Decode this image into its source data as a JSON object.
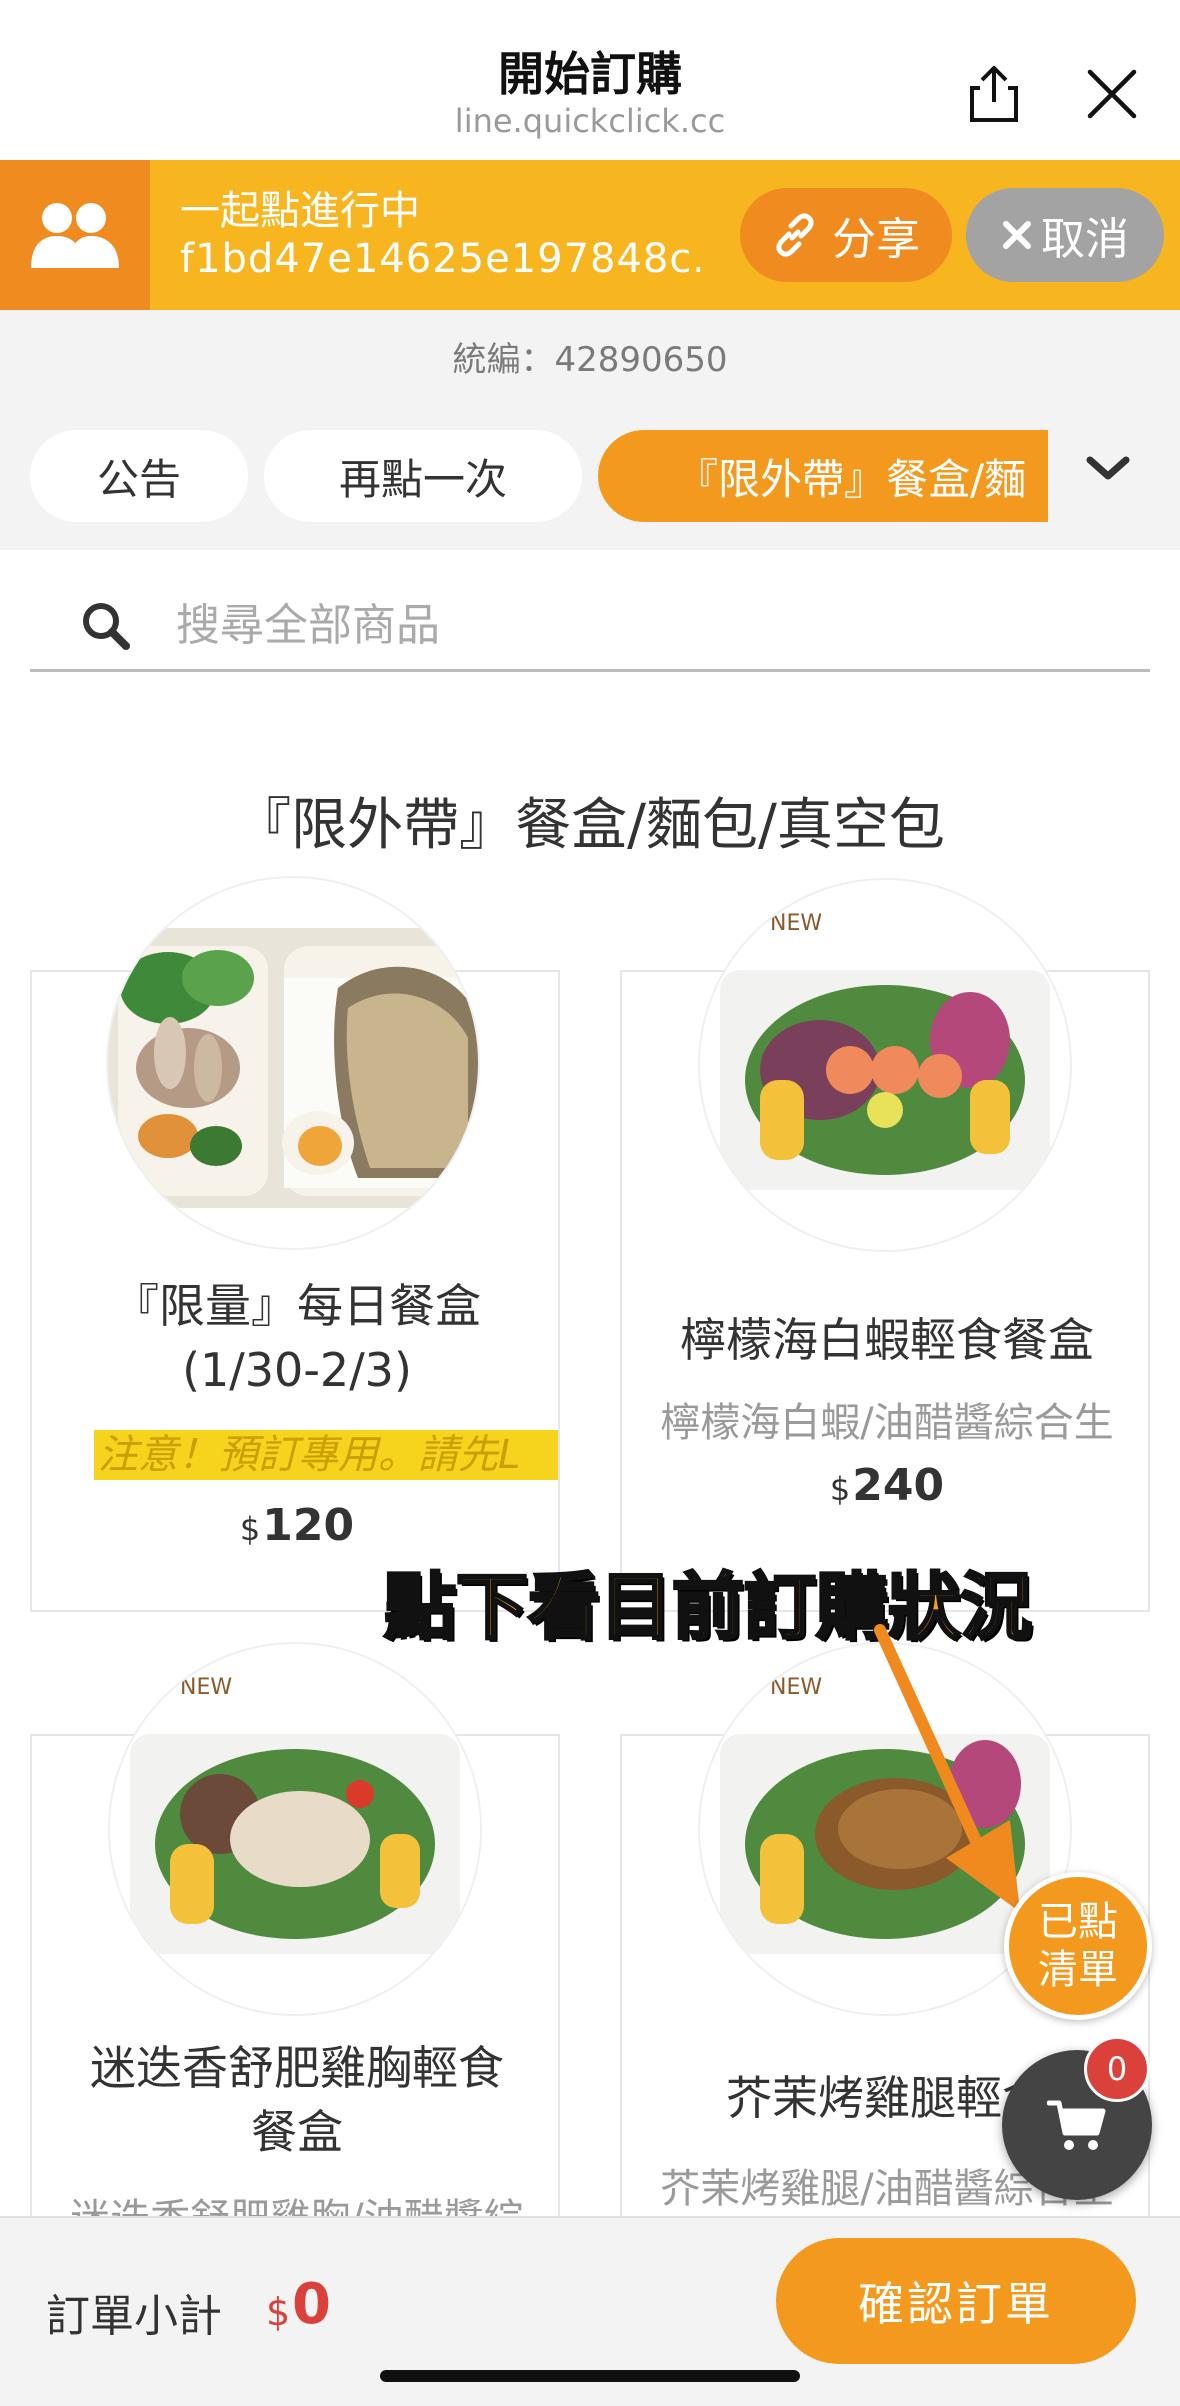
{
  "header": {
    "title": "開始訂購",
    "url": "line.quickclick.cc",
    "share_icon": "share-icon",
    "close_icon": "close-icon"
  },
  "group_order": {
    "status": "一起點進行中",
    "code": "f1bd47e14625e197848c...",
    "share_label": "分享",
    "cancel_label": "取消"
  },
  "store": {
    "tax_id": "統編：42890650"
  },
  "tabs": [
    {
      "label": "公告"
    },
    {
      "label": "再點一次"
    },
    {
      "label": "『限外帶』餐盒/麵",
      "active": true
    }
  ],
  "search": {
    "placeholder": "搜尋全部商品",
    "value": ""
  },
  "section": {
    "title": "『限外帶』餐盒/麵包/真空包"
  },
  "products": [
    {
      "name_line1": "『限量』每日餐盒",
      "name_line2": "(1/30-2/3)",
      "note": "注意！預訂專用。請先L",
      "currency": "$",
      "price": "120"
    },
    {
      "name": "檸檬海白蝦輕食餐盒",
      "desc": "檸檬海白蝦/油醋醬綜合生",
      "currency": "$",
      "price": "240"
    },
    {
      "name_line1": "迷迭香舒肥雞胸輕食",
      "name_line2": "餐盒",
      "desc": "迷迭香舒肥雞胸/油醋醬綜"
    },
    {
      "name": "芥茉烤雞腿輕食",
      "desc": "芥茉烤雞腿/油醋醬綜合生"
    }
  ],
  "annotation": {
    "text": "點下看目前訂購狀況"
  },
  "floating": {
    "list_label_line1": "已點",
    "list_label_line2": "清單",
    "cart_count": "0"
  },
  "bottom": {
    "subtotal_label": "訂單小計",
    "currency": "$",
    "subtotal": "0",
    "confirm_label": "確認訂單"
  },
  "colors": {
    "accent_orange": "#f39a1e",
    "banner_yellow": "#f7b520",
    "price_red": "#d9413a"
  }
}
